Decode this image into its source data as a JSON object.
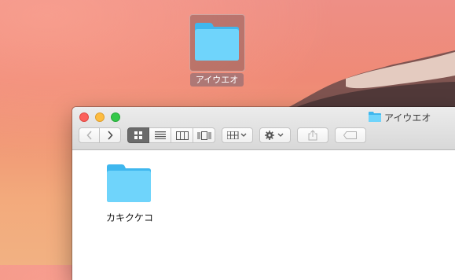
{
  "desktop": {
    "icon_label": "アイウエオ"
  },
  "window": {
    "title": "アイウエオ",
    "items": [
      {
        "label": "カキクケコ"
      }
    ]
  },
  "colors": {
    "folder_light": "#6fd4fb",
    "folder_dark": "#3fb7ee",
    "close": "#fc605b",
    "minimize": "#fdbc40",
    "zoom": "#34c84a"
  },
  "icons": {
    "back": "chevron-left-icon",
    "forward": "chevron-right-icon",
    "view_icon": "icon-view-icon",
    "view_list": "list-view-icon",
    "view_column": "column-view-icon",
    "view_coverflow": "coverflow-view-icon",
    "arrange": "arrange-icon",
    "action": "gear-icon",
    "share": "share-icon",
    "tags": "tag-icon"
  }
}
